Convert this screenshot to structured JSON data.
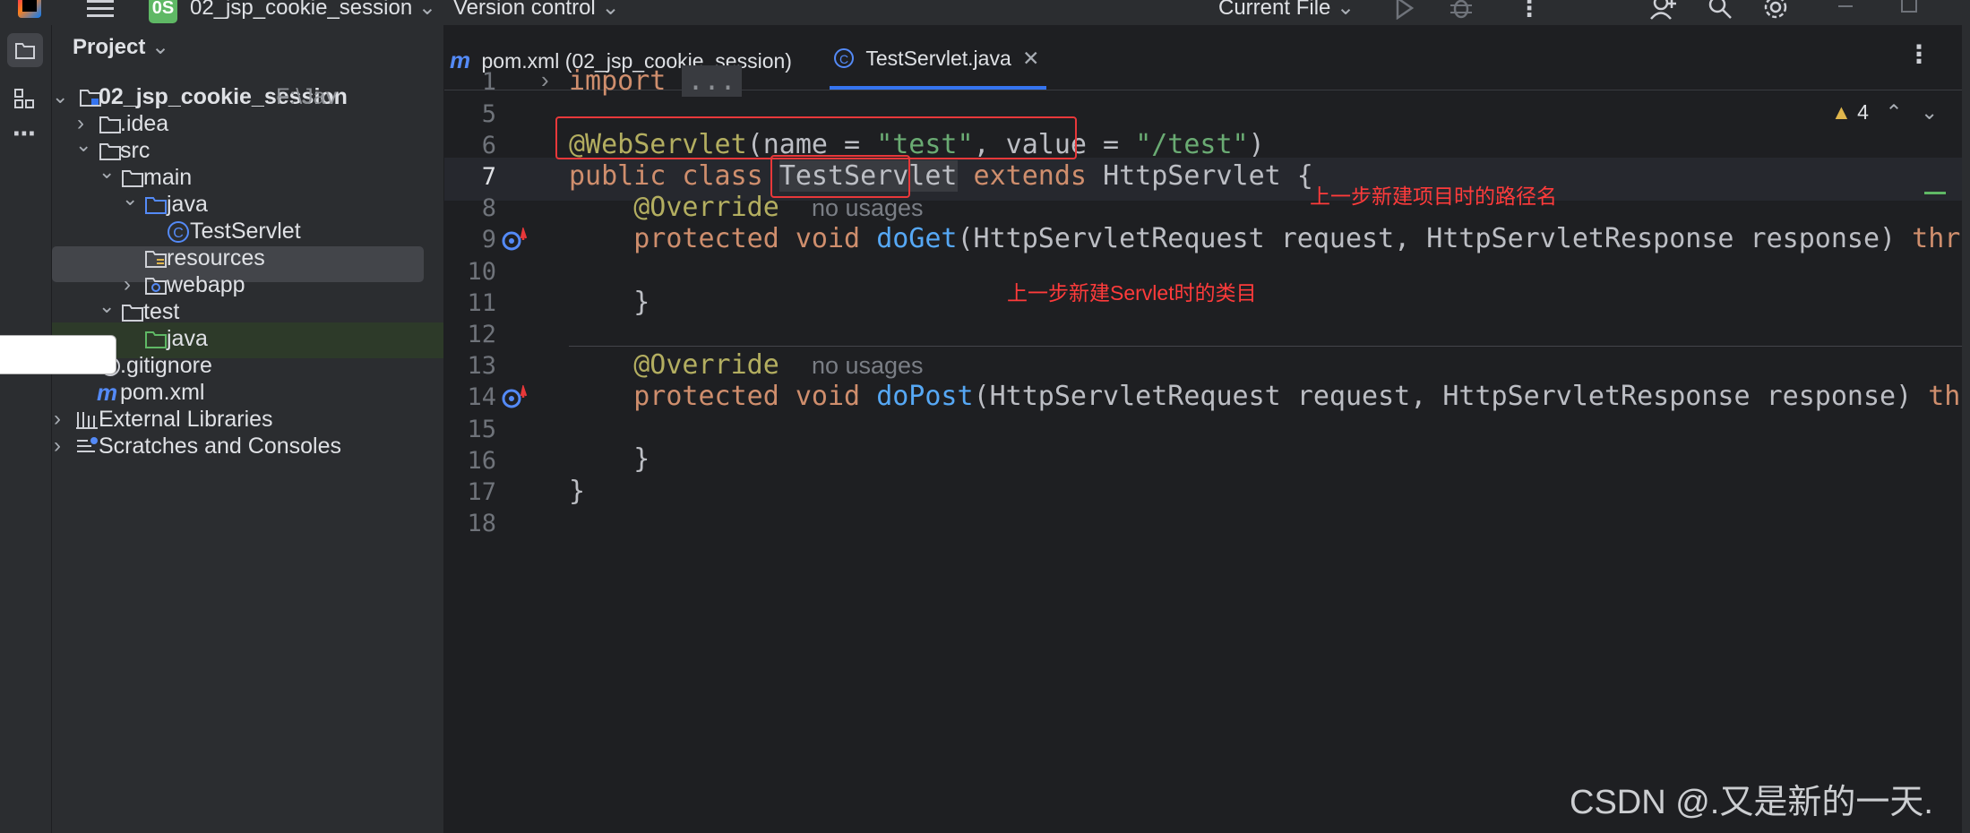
{
  "titlebar": {
    "project_badge": "0S",
    "project_name": "02_jsp_cookie_session",
    "vcs_label": "Version control",
    "run_config": "Current File"
  },
  "project_panel": {
    "title": "Project",
    "root_name": "02_jsp_cookie_session",
    "root_path": "F:\\Jav",
    "items": [
      {
        "label": ".idea"
      },
      {
        "label": "src"
      },
      {
        "label": "main"
      },
      {
        "label": "java"
      },
      {
        "label": "TestServlet"
      },
      {
        "label": "resources"
      },
      {
        "label": "webapp"
      },
      {
        "label": "test"
      },
      {
        "label": "java"
      },
      {
        "label": ".gitignore"
      },
      {
        "label": "pom.xml"
      },
      {
        "label": "External Libraries"
      },
      {
        "label": "Scratches and Consoles"
      }
    ]
  },
  "tabs": [
    {
      "label": "pom.xml (02_jsp_cookie_session)"
    },
    {
      "label": "TestServlet.java"
    }
  ],
  "editor": {
    "warnings": "4",
    "line_numbers": [
      "1",
      "5",
      "6",
      "7",
      "8",
      "9",
      "10",
      "11",
      "12",
      "13",
      "14",
      "15",
      "16",
      "17",
      "18"
    ],
    "code": {
      "import_kw": "import",
      "import_fold": "...",
      "ann_webservlet": "@WebServlet",
      "ann_args_open": "(name = ",
      "ann_name_val": "\"test\"",
      "ann_args_mid": ", value = ",
      "ann_value_val": "\"/test\"",
      "ann_args_close": ")",
      "public_class": "public class ",
      "class_name": "TestServlet",
      "extends_kw": " extends ",
      "extends_type": "HttpServlet {",
      "override": "@Override",
      "no_usages": "no usages",
      "protected_void": "protected void ",
      "doget": "doGet",
      "doget_params": "(HttpServletRequest request, HttpServletResponse response) ",
      "throws_cut1": "thr",
      "dopost": "doPost",
      "dopost_params": "(HttpServletRequest request, HttpServletResponse response) ",
      "throws_cut2": "th",
      "close_brace": "}"
    },
    "notes": {
      "path_note": "上一步新建项目时的路径名",
      "class_note": "上一步新建Servlet时的类目"
    }
  },
  "watermark": "CSDN @.又是新的一天.",
  "colors": {
    "accent": "#3574f0",
    "annotation_red": "#e8383a",
    "keyword": "#cf8e6d",
    "string": "#6aab73",
    "function": "#56a8f5",
    "annotation": "#b3ae60"
  }
}
